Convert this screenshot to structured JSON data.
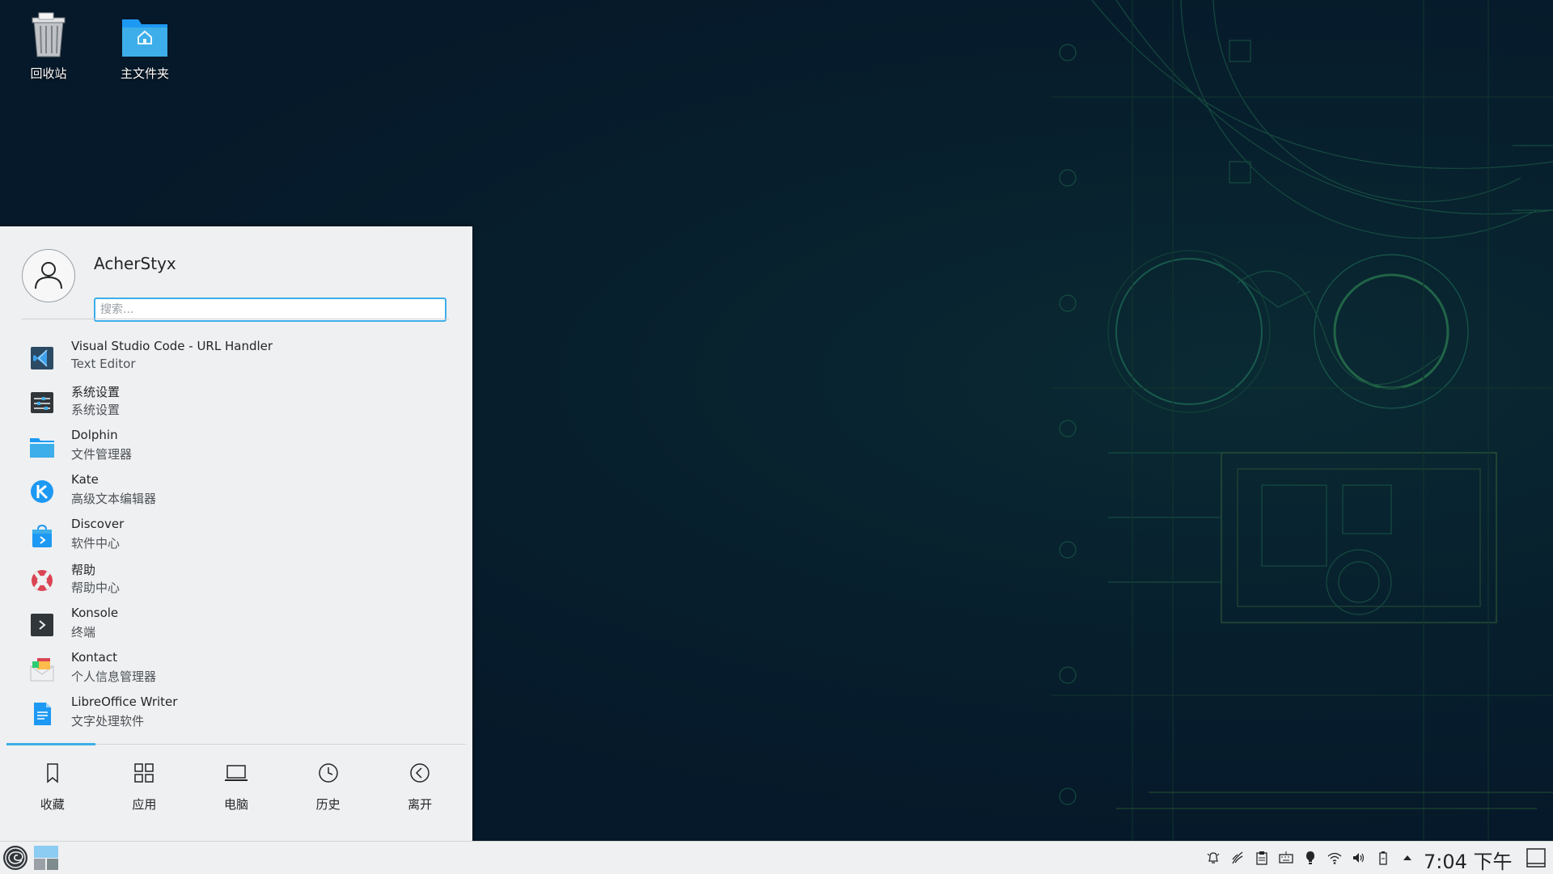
{
  "desktop": {
    "icons": [
      {
        "label": "回收站",
        "icon": "trash-icon"
      },
      {
        "label": "主文件夹",
        "icon": "home-folder-icon"
      }
    ]
  },
  "launcher": {
    "user": {
      "name": "AcherStyx"
    },
    "search": {
      "placeholder": "搜索...",
      "value": ""
    },
    "apps": [
      {
        "name": "Visual Studio Code - URL Handler",
        "desc": "Text Editor",
        "icon": "vscode-icon"
      },
      {
        "name": "系统设置",
        "desc": "系统设置",
        "icon": "settings-icon"
      },
      {
        "name": "Dolphin",
        "desc": "文件管理器",
        "icon": "dolphin-folder-icon"
      },
      {
        "name": "Kate",
        "desc": "高级文本编辑器",
        "icon": "kate-icon"
      },
      {
        "name": "Discover",
        "desc": "软件中心",
        "icon": "discover-icon"
      },
      {
        "name": "帮助",
        "desc": "帮助中心",
        "icon": "help-lifebuoy-icon"
      },
      {
        "name": "Konsole",
        "desc": "终端",
        "icon": "konsole-icon"
      },
      {
        "name": "Kontact",
        "desc": "个人信息管理器",
        "icon": "kontact-icon"
      },
      {
        "name": "LibreOffice Writer",
        "desc": "文字处理软件",
        "icon": "writer-icon"
      }
    ],
    "tabs": [
      {
        "label": "收藏",
        "icon": "bookmark-icon",
        "active": true
      },
      {
        "label": "应用",
        "icon": "grid-icon"
      },
      {
        "label": "电脑",
        "icon": "laptop-icon"
      },
      {
        "label": "历史",
        "icon": "clock-icon"
      },
      {
        "label": "离开",
        "icon": "leave-icon"
      }
    ]
  },
  "panel": {
    "clock": "7:04 下午",
    "tray": [
      "notifications-icon",
      "klipper-icon",
      "clipboard-icon",
      "keyboard-icon",
      "bulb-icon",
      "wifi-icon",
      "volume-icon",
      "battery-icon",
      "expand-arrow-icon"
    ]
  },
  "colors": {
    "accent": "#3daee9",
    "panel_bg": "#eff0f1",
    "wallpaper": "#06192a"
  }
}
